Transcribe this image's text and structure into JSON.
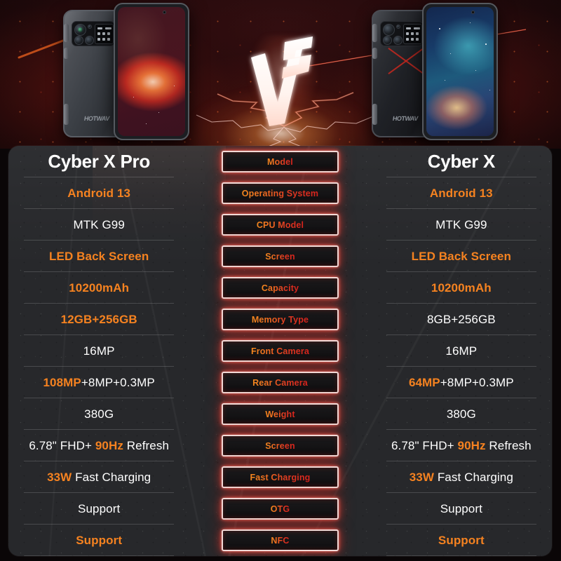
{
  "hero": {
    "vs_label": "VS",
    "left_phone_name": "Cyber X Pro",
    "right_phone_name": "Cyber X",
    "left_brand_logo": "HOTWAV",
    "right_brand_logo": "HOTWAV"
  },
  "table": {
    "left_title": "Cyber X Pro",
    "right_title": "Cyber X",
    "labels": [
      "Model",
      "Operating System",
      "CPU Model",
      "Screen",
      "Capacity",
      "Memory Type",
      "Front Camera",
      "Rear Camera",
      "Weight",
      "Screen",
      "Fast Charging",
      "OTG",
      "NFC"
    ],
    "rows": [
      {
        "label": "Operating System",
        "left": "Android 13",
        "left_hl": "all",
        "right": "Android 13",
        "right_hl": "all"
      },
      {
        "label": "CPU Model",
        "left": "MTK G99",
        "left_hl": "none",
        "right": "MTK G99",
        "right_hl": "none"
      },
      {
        "label": "Screen",
        "left": "LED Back Screen",
        "left_hl": "all",
        "right": "LED Back Screen",
        "right_hl": "all"
      },
      {
        "label": "Capacity",
        "left": "10200mAh",
        "left_hl": "all",
        "right": "10200mAh",
        "right_hl": "all"
      },
      {
        "label": "Memory Type",
        "left": "12GB+256GB",
        "left_hl": "all",
        "right": "8GB+256GB",
        "right_hl": "none"
      },
      {
        "label": "Front Camera",
        "left": "16MP",
        "left_hl": "none",
        "right": "16MP",
        "right_hl": "none"
      },
      {
        "label": "Rear Camera",
        "left": "108MP+8MP+0.3MP",
        "left_hl": "prefix:108MP",
        "right": "64MP+8MP+0.3MP",
        "right_hl": "prefix:64MP"
      },
      {
        "label": "Weight",
        "left": "380G",
        "left_hl": "none",
        "right": "380G",
        "right_hl": "none"
      },
      {
        "label": "Screen",
        "left": "6.78\" FHD+ 90Hz Refresh",
        "left_hl": "mid:90Hz",
        "right": "6.78\" FHD+ 90Hz Refresh",
        "right_hl": "mid:90Hz"
      },
      {
        "label": "Fast Charging",
        "left": "33W Fast Charging",
        "left_hl": "prefix:33W",
        "right": "33W Fast Charging",
        "right_hl": "prefix:33W"
      },
      {
        "label": "OTG",
        "left": "Support",
        "left_hl": "none",
        "right": "Support",
        "right_hl": "none"
      },
      {
        "label": "NFC",
        "left": "Support",
        "left_hl": "all",
        "right": "Support",
        "right_hl": "all"
      }
    ]
  },
  "colors": {
    "accent_orange": "#f58220",
    "badge_red": "#d8221c",
    "panel_bg": "#27282b",
    "text_white": "#ffffff",
    "hero_bg": "#0d0507"
  }
}
